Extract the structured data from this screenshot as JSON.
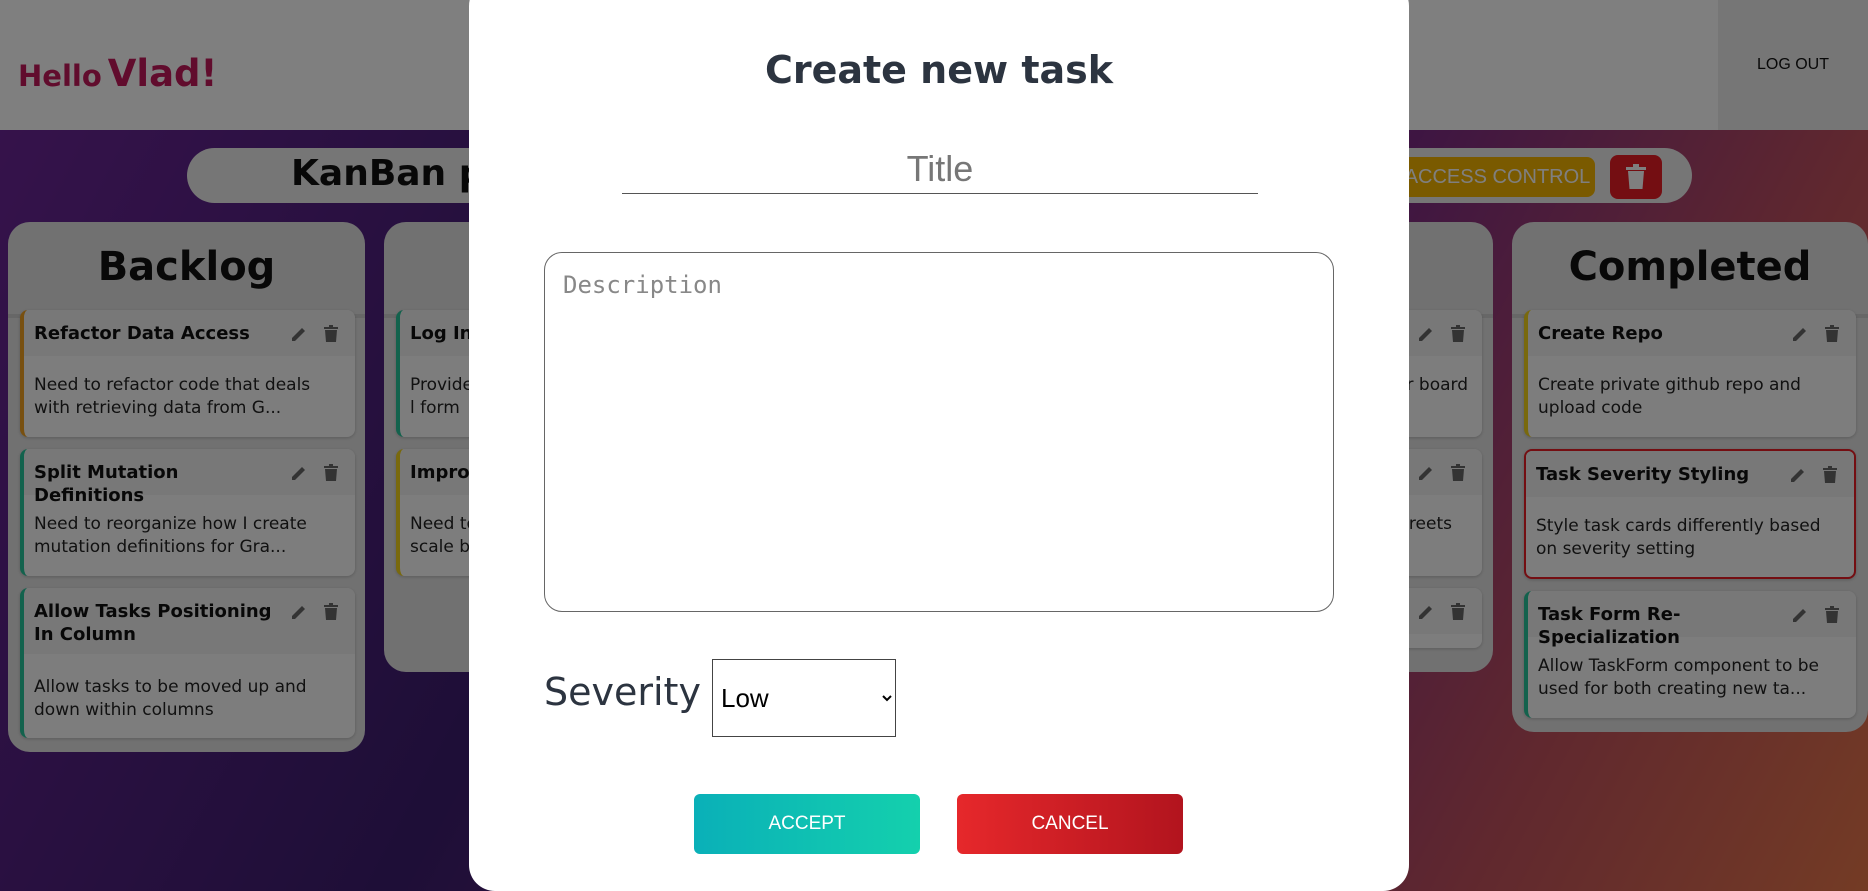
{
  "header": {
    "greeting": "Hello",
    "user_name": "Vlad!",
    "logout_label": "LOG OUT"
  },
  "project": {
    "title": "KanBan pro",
    "access_control_label": "ACCESS CONTROL"
  },
  "columns": [
    {
      "title": "Backlog",
      "cards": [
        {
          "title": "Refactor Data Access",
          "description": "Need to refactor code that deals with retrieving data from G...",
          "severity": "high"
        },
        {
          "title": "Split Mutation Definitions",
          "description": "Need to reorganize how I create mutation definitions for Gra...",
          "severity": "low"
        },
        {
          "title": "Allow Tasks Positioning In Column",
          "description": "Allow tasks to be moved up and down within columns",
          "severity": "low"
        }
      ]
    },
    {
      "title": "",
      "cards": [
        {
          "title": "Log In I",
          "description": "Provide l form",
          "severity": "low"
        },
        {
          "title": "Improv",
          "description": "Need to scale bet",
          "severity": "medium"
        }
      ]
    },
    {
      "title": "",
      "cards": [
        {
          "title": "",
          "description": "r board",
          "severity": "low"
        },
        {
          "title": "",
          "description": "greets",
          "severity": "low"
        },
        {
          "title": "",
          "description": "",
          "severity": "low"
        }
      ]
    },
    {
      "title": "Completed",
      "cards": [
        {
          "title": "Create Repo",
          "description": "Create private github repo and upload code",
          "severity": "medium"
        },
        {
          "title": "Task Severity Styling",
          "description": "Style task cards differently based on severity setting",
          "severity": "selected"
        },
        {
          "title": "Task Form Re-Specialization",
          "description": "Allow TaskForm component to be used for both creating new ta...",
          "severity": "low"
        }
      ]
    }
  ],
  "colors": {
    "severity_low": "#27c49a",
    "severity_medium": "#f2d21b",
    "severity_high": "#f0a020",
    "selected_border": "#e81c24",
    "accept": "#14c0b0",
    "cancel": "#d21f26"
  },
  "modal": {
    "title": "Create new task",
    "title_placeholder": "Title",
    "description_placeholder": "Description",
    "severity_label": "Severity",
    "severity_value": "Low",
    "accept_label": "ACCEPT",
    "cancel_label": "CANCEL"
  }
}
